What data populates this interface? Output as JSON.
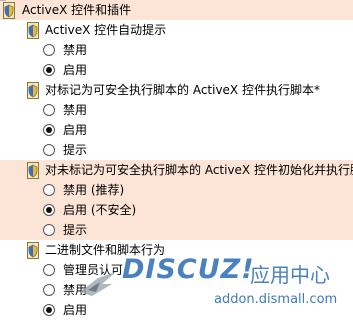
{
  "rows": [
    {
      "kind": "header",
      "label": "ActiveX 控件和插件",
      "highlighted": true,
      "icon": "security-shield-icon"
    },
    {
      "kind": "setting",
      "label": "ActiveX 控件自动提示",
      "highlighted": false,
      "icon": "security-shield-icon"
    },
    {
      "kind": "option",
      "label": "禁用",
      "selected": false
    },
    {
      "kind": "option",
      "label": "启用",
      "selected": true
    },
    {
      "kind": "setting",
      "label": "对标记为可安全执行脚本的 ActiveX 控件执行脚本*",
      "highlighted": false,
      "icon": "security-shield-icon"
    },
    {
      "kind": "option",
      "label": "禁用",
      "selected": false
    },
    {
      "kind": "option",
      "label": "启用",
      "selected": true
    },
    {
      "kind": "option",
      "label": "提示",
      "selected": false
    },
    {
      "kind": "setting",
      "label": "对未标记为可安全执行脚本的 ActiveX 控件初始化并执行脚",
      "highlighted": true,
      "icon": "security-shield-icon"
    },
    {
      "kind": "option",
      "label": "禁用 (推荐)",
      "selected": false,
      "highlighted": true
    },
    {
      "kind": "option",
      "label": "启用 (不安全)",
      "selected": true,
      "highlighted": true
    },
    {
      "kind": "option",
      "label": "提示",
      "selected": false,
      "highlighted": true
    },
    {
      "kind": "setting",
      "label": "二进制文件和脚本行为",
      "highlighted": false,
      "icon": "security-shield-icon"
    },
    {
      "kind": "option",
      "label": "管理员认可",
      "selected": false
    },
    {
      "kind": "option",
      "label": "禁用",
      "selected": false
    },
    {
      "kind": "option",
      "label": "启用",
      "selected": true
    }
  ],
  "watermark": {
    "logo": "DISCUZ!",
    "chinese": "应用中心",
    "url": "addon.dismall.com"
  },
  "colors": {
    "highlight": "#fce4d6",
    "watermark": "#2a6db5"
  }
}
